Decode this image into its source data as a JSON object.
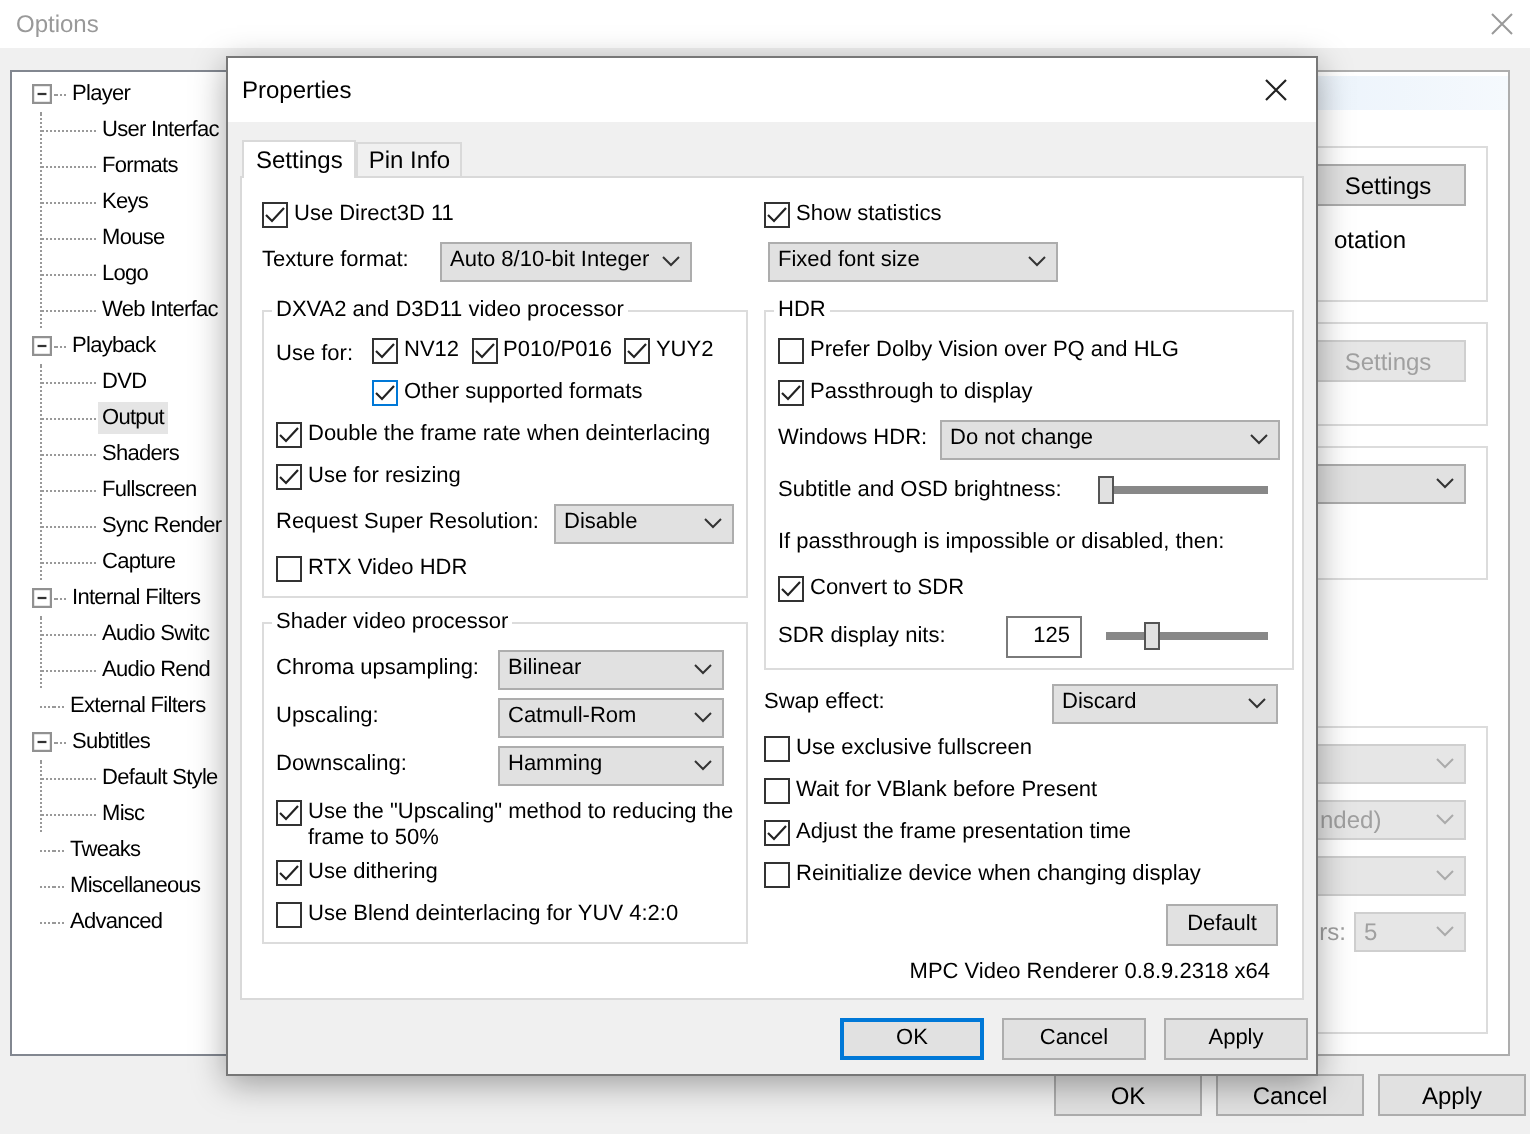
{
  "options_window": {
    "title": "Options",
    "tree": [
      {
        "label": "Player",
        "expanded": true,
        "selected": false,
        "children": [
          {
            "label": "User Interfac",
            "selected": false
          },
          {
            "label": "Formats",
            "selected": false
          },
          {
            "label": "Keys",
            "selected": false
          },
          {
            "label": "Mouse",
            "selected": false
          },
          {
            "label": "Logo",
            "selected": false
          },
          {
            "label": "Web Interfac",
            "selected": false
          }
        ]
      },
      {
        "label": "Playback",
        "expanded": true,
        "selected": false,
        "children": [
          {
            "label": "DVD",
            "selected": false
          },
          {
            "label": "Output",
            "selected": true
          },
          {
            "label": "Shaders",
            "selected": false
          },
          {
            "label": "Fullscreen",
            "selected": false
          },
          {
            "label": "Sync Render",
            "selected": false
          },
          {
            "label": "Capture",
            "selected": false
          }
        ]
      },
      {
        "label": "Internal Filters",
        "expanded": true,
        "selected": false,
        "children": [
          {
            "label": "Audio Switc",
            "selected": false
          },
          {
            "label": "Audio Rend",
            "selected": false
          }
        ]
      },
      {
        "label": "External Filters",
        "selected": false
      },
      {
        "label": "Subtitles",
        "expanded": true,
        "selected": false,
        "children": [
          {
            "label": "Default Style",
            "selected": false
          },
          {
            "label": "Misc",
            "selected": false
          }
        ]
      },
      {
        "label": "Tweaks",
        "selected": false
      },
      {
        "label": "Miscellaneous",
        "selected": false
      },
      {
        "label": "Advanced",
        "selected": false
      }
    ],
    "right_panel": {
      "groups": [
        {
          "items": [
            {
              "kind": "button",
              "label": "Settings",
              "disabled": false
            },
            {
              "kind": "text",
              "text": "otation"
            }
          ]
        },
        {
          "items": [
            {
              "kind": "button",
              "label": "Settings",
              "disabled": true
            }
          ]
        },
        {
          "items": [
            {
              "kind": "select",
              "disabled": false
            }
          ]
        },
        {
          "items": [
            {
              "kind": "select",
              "disabled": true
            },
            {
              "kind": "select",
              "value": "nded)",
              "disabled": true
            },
            {
              "kind": "select",
              "disabled": true
            },
            {
              "kind": "select",
              "label": "rs:",
              "value": "5",
              "disabled": true
            }
          ]
        }
      ]
    },
    "buttons": [
      {
        "label": "OK"
      },
      {
        "label": "Cancel"
      },
      {
        "label": "Apply"
      }
    ]
  },
  "dialog": {
    "title": "Properties",
    "tabs": [
      {
        "label": "Settings",
        "selected": true
      },
      {
        "label": "Pin Info",
        "selected": false
      }
    ],
    "left": [
      {
        "kind": "checkbox",
        "label": "Use Direct3D 11",
        "checked": true
      },
      {
        "kind": "select",
        "label": "Texture format:",
        "value": "Auto 8/10-bit Integer"
      },
      {
        "kind": "group",
        "title": "DXVA2 and D3D11 video processor",
        "rows": [
          {
            "kind": "checks_row",
            "label": "Use for:",
            "items": [
              {
                "kind": "checkbox",
                "label": "NV12",
                "checked": true
              },
              {
                "kind": "checkbox",
                "label": "P010/P016",
                "checked": true
              },
              {
                "kind": "checkbox",
                "label": "YUY2",
                "checked": true
              }
            ],
            "more": {
              "kind": "checkbox",
              "label": "Other supported formats",
              "checked": true,
              "focused": true
            }
          },
          {
            "kind": "checkbox",
            "label": "Double the frame rate when deinterlacing",
            "checked": true
          },
          {
            "kind": "checkbox",
            "label": "Use for resizing",
            "checked": true
          },
          {
            "kind": "select",
            "label": "Request Super Resolution:",
            "value": "Disable"
          },
          {
            "kind": "checkbox",
            "label": "RTX Video HDR",
            "checked": false
          }
        ]
      },
      {
        "kind": "group",
        "title": "Shader video processor",
        "rows": [
          {
            "kind": "select",
            "label": "Chroma upsampling:",
            "value": "Bilinear"
          },
          {
            "kind": "select",
            "label": "Upscaling:",
            "value": "Catmull-Rom"
          },
          {
            "kind": "select",
            "label": "Downscaling:",
            "value": "Hamming"
          },
          {
            "kind": "checkbox",
            "label": "Use the \"Upscaling\" method to reducing the frame to 50%",
            "checked": true
          },
          {
            "kind": "checkbox",
            "label": "Use dithering",
            "checked": true
          },
          {
            "kind": "checkbox",
            "label": "Use Blend deinterlacing for YUV 4:2:0",
            "checked": false
          }
        ]
      }
    ],
    "right": [
      {
        "kind": "checkbox",
        "label": "Show statistics",
        "checked": true
      },
      {
        "kind": "select",
        "value": "Fixed font size"
      },
      {
        "kind": "group",
        "title": "HDR",
        "rows": [
          {
            "kind": "checkbox",
            "label": "Prefer Dolby Vision over PQ and HLG",
            "checked": false
          },
          {
            "kind": "checkbox",
            "label": "Passthrough to display",
            "checked": true
          },
          {
            "kind": "select",
            "label": "Windows HDR:",
            "value": "Do not change"
          },
          {
            "kind": "slider",
            "label": "Subtitle and OSD brightness:",
            "level": 0
          },
          {
            "kind": "text",
            "text": "If passthrough is impossible or disabled, then:"
          },
          {
            "kind": "checkbox",
            "label": "Convert to SDR",
            "checked": true
          },
          {
            "kind": "input_slider",
            "label": "SDR display nits:",
            "value": "125",
            "level": 0.28
          }
        ]
      },
      {
        "kind": "select",
        "label": "Swap effect:",
        "value": "Discard"
      },
      {
        "kind": "checkbox",
        "label": "Use exclusive fullscreen",
        "checked": false
      },
      {
        "kind": "checkbox",
        "label": "Wait for VBlank before Present",
        "checked": false
      },
      {
        "kind": "checkbox",
        "label": "Adjust the frame presentation time",
        "checked": true
      },
      {
        "kind": "checkbox",
        "label": "Reinitialize device when changing display",
        "checked": false
      },
      {
        "kind": "button",
        "label": "Default"
      },
      {
        "kind": "footer_text",
        "text": "MPC Video Renderer 0.8.9.2318 x64"
      }
    ],
    "buttons": [
      {
        "label": "OK",
        "focused": true
      },
      {
        "label": "Cancel",
        "focused": false
      },
      {
        "label": "Apply",
        "focused": false
      }
    ]
  }
}
